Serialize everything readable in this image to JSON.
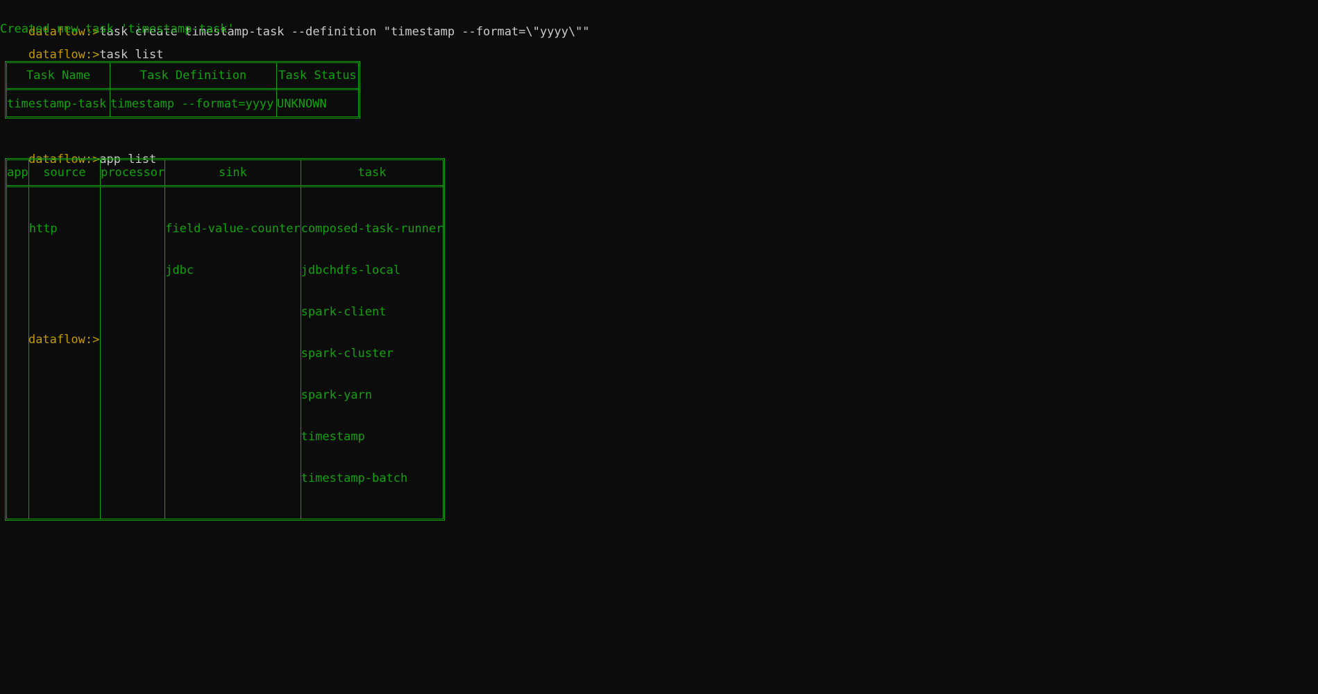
{
  "theme": {
    "background": "#0c0c0c",
    "prompt_color": "#c19c00",
    "command_color": "#cccccc",
    "output_color": "#13a10e"
  },
  "session": {
    "prompt": "dataflow:>",
    "cmd1": "task create timestamp-task --definition \"timestamp --format=\\\"yyyy\\\"\"",
    "out1": "Created new task 'timestamp-task'",
    "cmd2": "task list",
    "cmd3": "app list",
    "cmd4": ""
  },
  "task_table": {
    "headers": [
      "Task Name",
      "Task Definition",
      "Task Status"
    ],
    "rows": [
      [
        "timestamp-task",
        "timestamp --format=yyyy",
        "UNKNOWN"
      ]
    ]
  },
  "app_table": {
    "headers": [
      "app",
      "source",
      "processor",
      "sink",
      "task"
    ],
    "app": [],
    "source": [
      "http"
    ],
    "processor": [],
    "sink": [
      "field-value-counter",
      "jdbc"
    ],
    "task": [
      "composed-task-runner",
      "jdbchdfs-local",
      "spark-client",
      "spark-cluster",
      "spark-yarn",
      "timestamp",
      "timestamp-batch"
    ]
  }
}
